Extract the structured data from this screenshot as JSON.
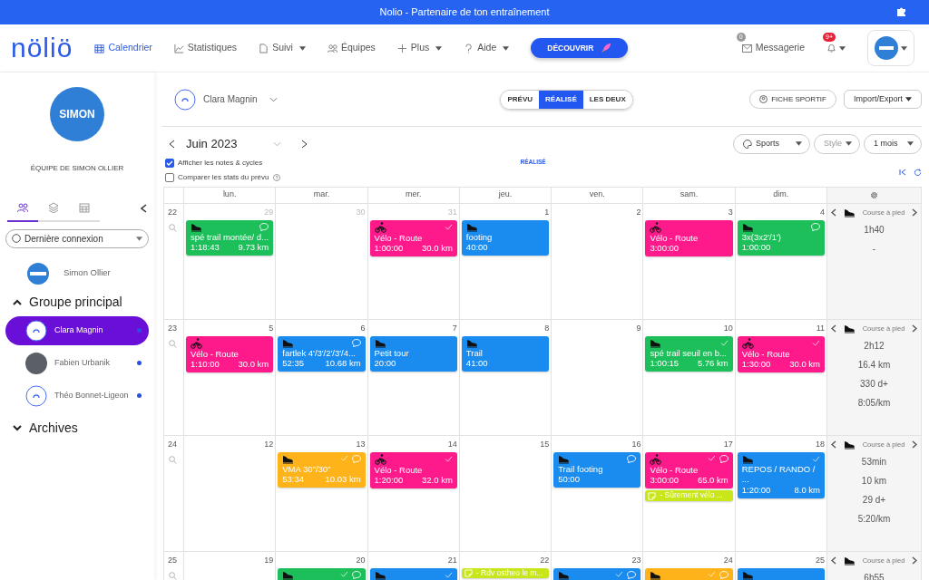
{
  "window": {
    "title": "Nolio - Partenaire de ton entraînement"
  },
  "nav": {
    "logo": "nöliö",
    "items": [
      {
        "label": "Calendrier",
        "selected": true,
        "dropdown": false
      },
      {
        "label": "Statistiques",
        "selected": false,
        "dropdown": false
      },
      {
        "label": "Suivi",
        "selected": false,
        "dropdown": true
      },
      {
        "label": "Équipes",
        "selected": false,
        "dropdown": false
      },
      {
        "label": "Plus",
        "selected": false,
        "dropdown": true
      },
      {
        "label": "Aide",
        "selected": false,
        "dropdown": true
      }
    ],
    "cta": "DÉCOUVRIR",
    "messages": {
      "label": "Messagerie",
      "count": "0"
    },
    "notifications": {
      "count": "9+"
    }
  },
  "sidebar": {
    "team": {
      "logo_text": "SIMON",
      "name": "ÉQUIPE DE SIMON OLLIER"
    },
    "tabs": [
      {
        "selected": true
      },
      {
        "selected": false
      },
      {
        "selected": false
      }
    ],
    "sort_select": {
      "value": "Dernière connexion"
    },
    "coach": {
      "name": "Simon Ollier",
      "kind": "logo"
    },
    "groups": [
      {
        "name": "Groupe principal",
        "expanded": true,
        "children": [
          {
            "name": "Clara Magnin",
            "kind": "default",
            "selected": true,
            "online": true
          },
          {
            "name": "Fabien Urbanik",
            "kind": "photo",
            "selected": false,
            "online": true
          },
          {
            "name": "Théo Bonnet-Ligeon",
            "kind": "default",
            "selected": false,
            "online": true
          }
        ]
      },
      {
        "name": "Archives",
        "expanded": false
      }
    ]
  },
  "header": {
    "athlete": "Clara Magnin",
    "view_toggle": [
      {
        "label": "PRÉVU",
        "selected": false
      },
      {
        "label": "RÉALISÉ",
        "selected": true
      },
      {
        "label": "LES DEUX",
        "selected": false
      }
    ],
    "actions": [
      "FICHE SPORTIF",
      "Import/Export"
    ],
    "month": "Juin 2023",
    "filters": [
      "Sports",
      "Style",
      "1 mois"
    ],
    "options": [
      {
        "label": "Afficher les notes & cycles",
        "checked": true
      },
      {
        "label": "Comparer les stats du prévu",
        "checked": false
      }
    ],
    "mode_label": "RÉALISÉ"
  },
  "calendar": {
    "weekdays": [
      "lun.",
      "mar.",
      "mer.",
      "jeu.",
      "ven.",
      "sam.",
      "dim."
    ],
    "weeks": [
      {
        "number": "22",
        "summary": {
          "sport": "Course à pied",
          "stats": [
            "1h40",
            "-"
          ]
        },
        "days": [
          {
            "date": "29",
            "other_month": true,
            "events": [
              {
                "kind": "run",
                "color": "#1dbf5a",
                "title": "spé trail montée/ d...",
                "time": "1:18:43",
                "distance": "9.73 km",
                "done": false,
                "comment": true
              }
            ]
          },
          {
            "date": "30",
            "other_month": true
          },
          {
            "date": "31",
            "other_month": true,
            "events": [
              {
                "kind": "bike",
                "color": "#ff1a8c",
                "title": "Vélo - Route",
                "time": "1:00:00",
                "distance": "30.0 km",
                "done": true,
                "comment": false
              }
            ]
          },
          {
            "date": "1",
            "other_month": false,
            "events": [
              {
                "kind": "run",
                "color": "#1a8cf0",
                "title": "footing",
                "time": "40:00",
                "done": false,
                "comment": false
              }
            ]
          },
          {
            "date": "2",
            "other_month": false
          },
          {
            "date": "3",
            "other_month": false,
            "events": [
              {
                "kind": "bike",
                "color": "#ff1a8c",
                "title": "Vélo - Route",
                "time": "3:00:00",
                "done": false,
                "comment": false
              }
            ]
          },
          {
            "date": "4",
            "other_month": false,
            "events": [
              {
                "kind": "run",
                "color": "#1dbf5a",
                "title": "3x(3x2'/1')",
                "time": "1:00:00",
                "done": false,
                "comment": true
              }
            ]
          }
        ]
      },
      {
        "number": "23",
        "summary": {
          "sport": "Course à pied",
          "stats": [
            "2h12",
            "16.4 km",
            "330 d+",
            "8:05/km"
          ]
        },
        "days": [
          {
            "date": "5",
            "other_month": false,
            "events": [
              {
                "kind": "bike",
                "color": "#ff1a8c",
                "title": "Vélo - Route",
                "time": "1:10:00",
                "distance": "30.0 km",
                "done": false,
                "comment": false
              }
            ]
          },
          {
            "date": "6",
            "other_month": false,
            "events": [
              {
                "kind": "run",
                "color": "#1a8cf0",
                "title": "fartlek 4'/3'/2'/3'/4...",
                "time": "52:35",
                "distance": "10.68 km",
                "done": false,
                "comment": true
              }
            ]
          },
          {
            "date": "7",
            "other_month": false,
            "events": [
              {
                "kind": "run",
                "color": "#1a8cf0",
                "title": "Petit tour",
                "time": "20:00",
                "done": false,
                "comment": false
              }
            ]
          },
          {
            "date": "8",
            "other_month": false,
            "events": [
              {
                "kind": "run",
                "color": "#1a8cf0",
                "title": "Trail",
                "time": "41:00",
                "done": false,
                "comment": false
              }
            ]
          },
          {
            "date": "9",
            "other_month": false
          },
          {
            "date": "10",
            "other_month": false,
            "events": [
              {
                "kind": "run",
                "color": "#1dbf5a",
                "title": "spé trail seuil en b...",
                "time": "1:00:15",
                "distance": "5.76 km",
                "done": true,
                "comment": false
              }
            ]
          },
          {
            "date": "11",
            "other_month": false,
            "events": [
              {
                "kind": "bike",
                "color": "#ff1a8c",
                "title": "Vélo - Route",
                "time": "1:30:00",
                "distance": "30.0 km",
                "done": true,
                "comment": false
              }
            ]
          }
        ]
      },
      {
        "number": "24",
        "summary": {
          "sport": "Course à pied",
          "stats": [
            "53min",
            "10 km",
            "29 d+",
            "5:20/km"
          ]
        },
        "days": [
          {
            "date": "12",
            "other_month": false
          },
          {
            "date": "13",
            "other_month": false,
            "events": [
              {
                "kind": "run",
                "color": "#ffb31a",
                "title": "VMA 30\"/30\"",
                "time": "53:34",
                "distance": "10.03 km",
                "done": true,
                "comment": true
              }
            ]
          },
          {
            "date": "14",
            "other_month": false,
            "events": [
              {
                "kind": "bike",
                "color": "#ff1a8c",
                "title": "Vélo - Route",
                "time": "1:20:00",
                "distance": "32.0 km",
                "done": true,
                "comment": false
              }
            ]
          },
          {
            "date": "15",
            "other_month": false
          },
          {
            "date": "16",
            "other_month": false,
            "events": [
              {
                "kind": "run",
                "color": "#1a8cf0",
                "title": "Trail footing",
                "time": "50:00",
                "done": false,
                "comment": true
              }
            ]
          },
          {
            "date": "17",
            "other_month": false,
            "events": [
              {
                "kind": "bike",
                "color": "#ff1a8c",
                "title": "Vélo - Route",
                "time": "3:00:00",
                "distance": "65.0 km",
                "done": true,
                "comment": true
              },
              {
                "kind": "note",
                "color": "#c8e61a",
                "title": "- Sûrement vélo ..."
              }
            ]
          },
          {
            "date": "18",
            "other_month": false,
            "events": [
              {
                "kind": "run",
                "color": "#1a8cf0",
                "title": "REPOS / RANDO / ...",
                "time": "1:20:00",
                "distance": "8.0 km",
                "done": true,
                "comment": false
              }
            ]
          }
        ]
      },
      {
        "number": "25",
        "summary": {
          "sport": "Course à pied",
          "stats": [
            "6h55"
          ]
        },
        "days": [
          {
            "date": "19",
            "other_month": false
          },
          {
            "date": "20",
            "other_month": false,
            "events": [
              {
                "kind": "run",
                "color": "#1dbf5a",
                "done": true,
                "comment": true
              }
            ]
          },
          {
            "date": "21",
            "other_month": false,
            "events": [
              {
                "kind": "run",
                "color": "#1a8cf0",
                "done": true,
                "comment": false
              }
            ]
          },
          {
            "date": "22",
            "other_month": false,
            "events": [
              {
                "kind": "note",
                "color": "#c8e61a",
                "title": "- Rdv ostheo le m..."
              }
            ]
          },
          {
            "date": "23",
            "other_month": false,
            "events": [
              {
                "kind": "run",
                "color": "#1a8cf0",
                "done": true,
                "comment": true
              }
            ]
          },
          {
            "date": "24",
            "other_month": false,
            "events": [
              {
                "kind": "run",
                "color": "#ffb31a",
                "done": true,
                "comment": true
              }
            ]
          },
          {
            "date": "25",
            "other_month": false,
            "events": [
              {
                "kind": "run",
                "color": "#1a8cf0",
                "done": false,
                "comment": false
              }
            ]
          }
        ]
      }
    ]
  }
}
